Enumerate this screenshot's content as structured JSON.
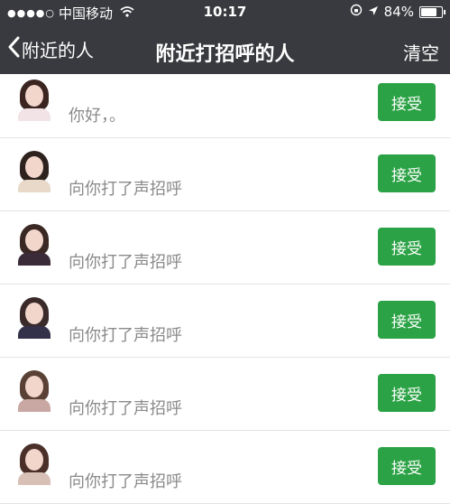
{
  "status_bar": {
    "carrier": "中国移动",
    "time": "10:17",
    "battery": "84%",
    "battery_fraction": 0.84
  },
  "nav": {
    "back_label": "附近的人",
    "title": "附近打招呼的人",
    "clear_label": "清空"
  },
  "requests": [
    {
      "name": "",
      "message": "你好，。",
      "accept_label": "接受",
      "avatar_colors": {
        "hair": "#3b2520",
        "body": "#f1e3e6"
      }
    },
    {
      "name": "",
      "message": "向你打了声招呼",
      "accept_label": "接受",
      "avatar_colors": {
        "hair": "#2e221e",
        "body": "#e8d9c9"
      }
    },
    {
      "name": "",
      "message": "向你打了声招呼",
      "accept_label": "接受",
      "avatar_colors": {
        "hair": "#3a2824",
        "body": "#3b2a38"
      }
    },
    {
      "name": "",
      "message": "向你打了声招呼",
      "accept_label": "接受",
      "avatar_colors": {
        "hair": "#3a2a2a",
        "body": "#33304a"
      }
    },
    {
      "name": "",
      "message": "向你打了声招呼",
      "accept_label": "接受",
      "avatar_colors": {
        "hair": "#5a4136",
        "body": "#c9a7a2"
      }
    },
    {
      "name": "",
      "message": "向你打了声招呼",
      "accept_label": "接受",
      "avatar_colors": {
        "hair": "#4a3028",
        "body": "#d8c0b7"
      }
    }
  ],
  "colors": {
    "header_bg": "#393a3f",
    "accept_button": "#2ba245",
    "message_text": "#8a8a8a"
  }
}
